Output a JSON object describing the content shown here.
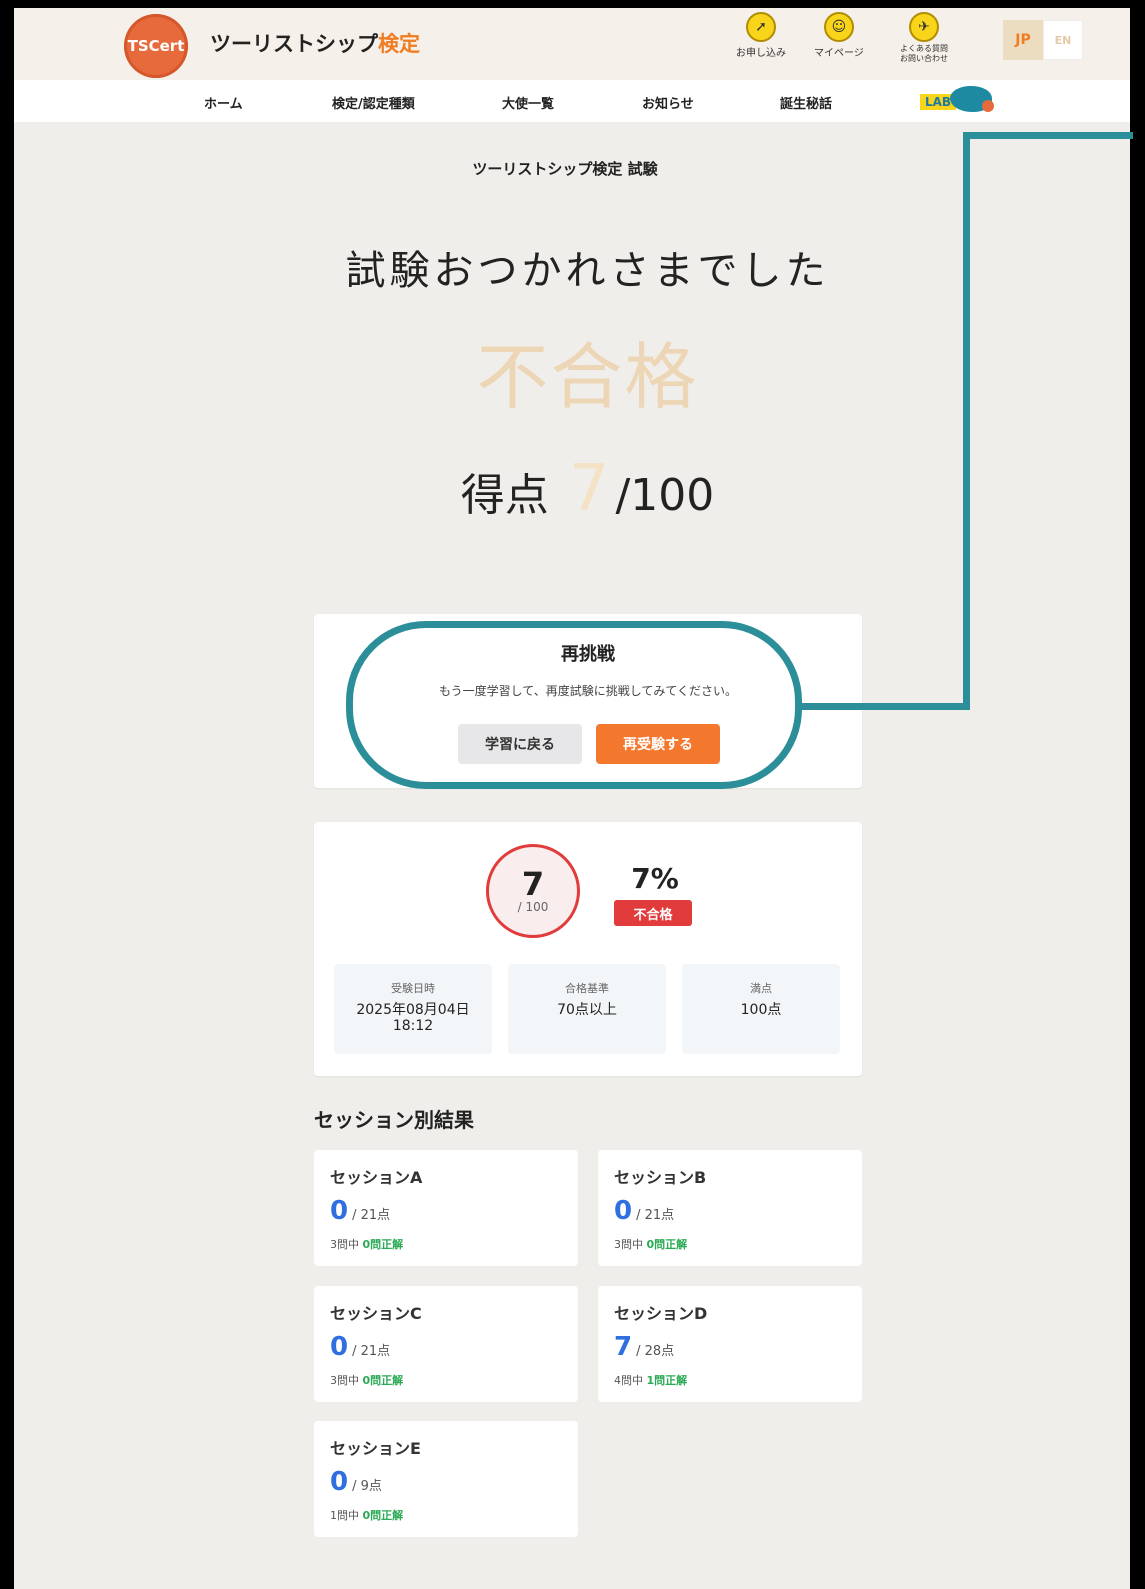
{
  "header": {
    "logo_text": "TSCert",
    "brand_main": "ツーリストシップ",
    "brand_accent": "検定",
    "links": [
      {
        "label": "お申し込み",
        "icon": "cursor-icon"
      },
      {
        "label": "マイページ",
        "icon": "user-icon"
      },
      {
        "label": "よくある質問\nお問い合わせ",
        "icon": "paper-plane-icon"
      }
    ],
    "lang": {
      "jp": "JP",
      "en": "EN"
    }
  },
  "nav": {
    "items": [
      "ホーム",
      "検定/認定種類",
      "大使一覧",
      "お知らせ",
      "誕生秘話"
    ],
    "lab": "LAB"
  },
  "main": {
    "crumb": "ツーリストシップ検定 試験",
    "headline": "試験おつかれさまでした",
    "result": "不合格",
    "score_label": "得点",
    "score_value": "7",
    "score_total": "/100"
  },
  "retry": {
    "title": "再挑戦",
    "description": "もう一度学習して、再度試験に挑戦してみてください。",
    "back_label": "学習に戻る",
    "retry_label": "再受験する"
  },
  "summary": {
    "score": "7",
    "out_of": "/ 100",
    "percent": "7%",
    "status": "不合格",
    "stats": [
      {
        "label": "受験日時",
        "value": "2025年08月04日\n18:12"
      },
      {
        "label": "合格基準",
        "value": "70点以上"
      },
      {
        "label": "満点",
        "value": "100点"
      }
    ]
  },
  "sessions": {
    "title": "セッション別結果",
    "items": [
      {
        "name": "セッションA",
        "score": "0",
        "max": "/ 21点",
        "q_total": "3問中",
        "q_correct": "0問正解"
      },
      {
        "name": "セッションB",
        "score": "0",
        "max": "/ 21点",
        "q_total": "3問中",
        "q_correct": "0問正解"
      },
      {
        "name": "セッションC",
        "score": "0",
        "max": "/ 21点",
        "q_total": "3問中",
        "q_correct": "0問正解"
      },
      {
        "name": "セッションD",
        "score": "7",
        "max": "/ 28点",
        "q_total": "4問中",
        "q_correct": "1問正解"
      },
      {
        "name": "セッションE",
        "score": "0",
        "max": "/ 9点",
        "q_total": "1問中",
        "q_correct": "0問正解"
      }
    ]
  },
  "colors": {
    "accent_orange": "#f4772e",
    "highlight_teal": "#2b8e99",
    "fail_red": "#e23b3b",
    "score_blue": "#2f6fe0"
  }
}
